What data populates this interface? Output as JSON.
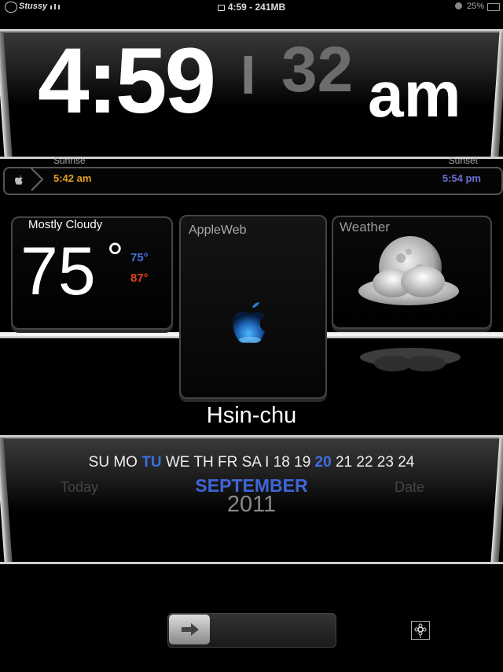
{
  "status_bar": {
    "carrier": "Stussy",
    "time_memory": "4:59 - 241MB",
    "battery": "25%"
  },
  "clock": {
    "time": "4:59",
    "separator": "I",
    "seconds": "32",
    "ampm": "am"
  },
  "sun": {
    "sunrise_label": "Sunrise",
    "sunrise_time": "5:42 am",
    "sunset_label": "Sunset",
    "sunset_time": "5:54 pm"
  },
  "weather_left": {
    "condition": "Mostly Cloudy",
    "temperature": "75",
    "degree": "°",
    "low": "75°",
    "high": "87°"
  },
  "appleweb": {
    "title": "AppleWeb"
  },
  "weather_right": {
    "title": "Weather"
  },
  "city": "Hsin-chu",
  "calendar": {
    "days_before": "SU MO ",
    "day_highlight": "TU",
    "days_after": " WE TH FR SA I 18 19 ",
    "date_highlight": "20",
    "dates_after": " 21 22 23 24",
    "today_label": "Today",
    "date_label": "Date",
    "month": "SEPTEMBER",
    "year": "2011"
  },
  "colors": {
    "accent_blue": "#3c6fe0",
    "sunrise": "#e0a020",
    "sunset": "#6d6fd6",
    "high_temp": "#e0401e"
  }
}
